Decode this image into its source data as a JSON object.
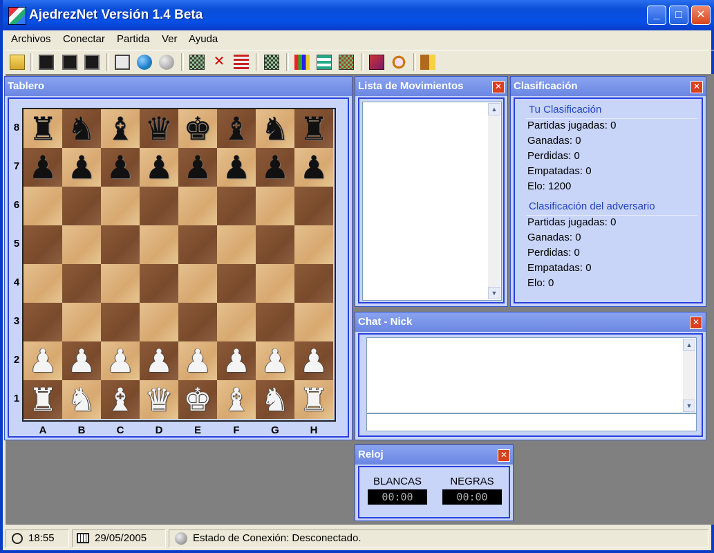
{
  "window": {
    "title": "AjedrezNet Versión 1.4 Beta",
    "min_label": "_",
    "max_label": "□",
    "close_label": "✕"
  },
  "menu": [
    "Archivos",
    "Conectar",
    "Partida",
    "Ver",
    "Ayuda"
  ],
  "toolbar_icons": [
    "open-folder-icon",
    "save-icon",
    "save-as-icon",
    "save-all-icon",
    "card-icon",
    "globe-icon",
    "globe-gray-icon",
    "board-icon",
    "cross-pieces-icon",
    "stack-icon",
    "board-small-icon",
    "color-bars-icon",
    "list-icon",
    "board-grid-icon",
    "book-icon",
    "magnifier-icon",
    "exit-door-icon"
  ],
  "board_panel": {
    "title": "Tablero",
    "ranks": [
      "8",
      "7",
      "6",
      "5",
      "4",
      "3",
      "2",
      "1"
    ],
    "files": [
      "A",
      "B",
      "C",
      "D",
      "E",
      "F",
      "G",
      "H"
    ],
    "position": [
      "rnbqkbnr",
      "pppppppp",
      "........",
      "........",
      "........",
      "........",
      "PPPPPPPP",
      "RNBQKBNR"
    ]
  },
  "moves_panel": {
    "title": "Lista de Movimientos",
    "close_label": "✕"
  },
  "rating_panel": {
    "title": "Clasificación",
    "close_label": "✕",
    "mine": {
      "title": "Tu Clasificación",
      "lines": [
        "Partidas jugadas: 0",
        "Ganadas: 0",
        "Perdidas: 0",
        "Empatadas: 0",
        "Elo: 1200"
      ]
    },
    "opponent": {
      "title": "Clasificación del adversario",
      "lines": [
        "Partidas jugadas: 0",
        "Ganadas: 0",
        "Perdidas: 0",
        "Empatadas: 0",
        "Elo: 0"
      ]
    }
  },
  "chat_panel": {
    "title": "Chat - Nick",
    "close_label": "✕",
    "input_value": ""
  },
  "clock_panel": {
    "title": "Reloj",
    "close_label": "✕",
    "white_label": "BLANCAS",
    "white_time": "00:00",
    "black_label": "NEGRAS",
    "black_time": "00:00"
  },
  "status": {
    "time": "18:55",
    "date": "29/05/2005",
    "connection": "Estado de Conexión: Desconectado."
  }
}
